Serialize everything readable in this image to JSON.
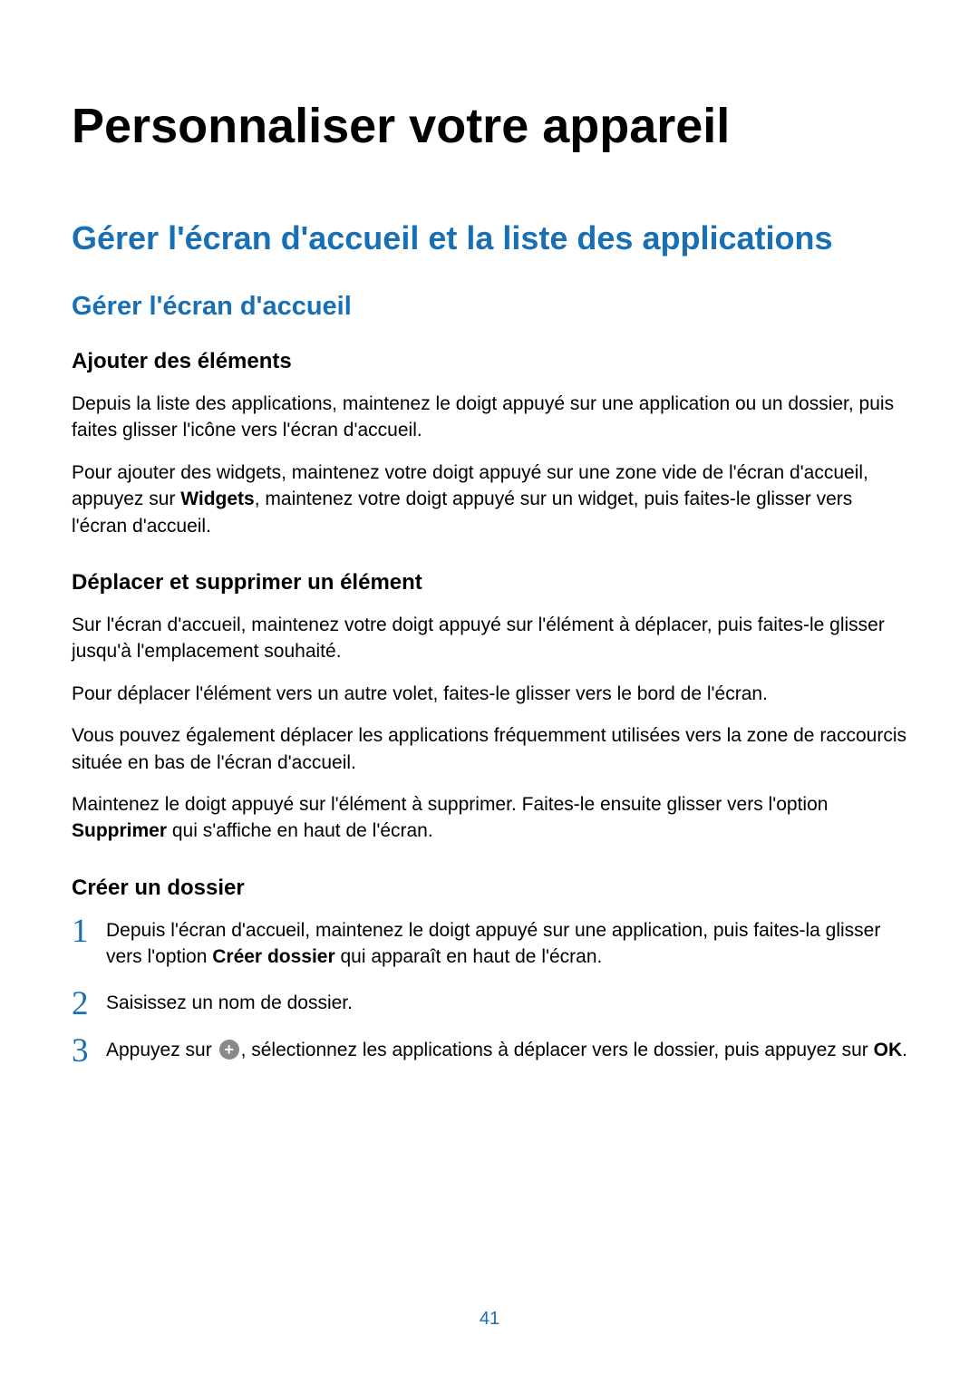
{
  "chapter_title": "Personnaliser votre appareil",
  "section_title": "Gérer l'écran d'accueil et la liste des applications",
  "subsection_title": "Gérer l'écran d'accueil",
  "topics": {
    "ajouter": {
      "title": "Ajouter des éléments",
      "p1": "Depuis la liste des applications, maintenez le doigt appuyé sur une application ou un dossier, puis faites glisser l'icône vers l'écran d'accueil.",
      "p2_pre": "Pour ajouter des widgets, maintenez votre doigt appuyé sur une zone vide de l'écran d'accueil, appuyez sur ",
      "p2_bold": "Widgets",
      "p2_post": ", maintenez votre doigt appuyé sur un widget, puis faites-le glisser vers l'écran d'accueil."
    },
    "deplacer": {
      "title": "Déplacer et supprimer un élément",
      "p1": "Sur l'écran d'accueil, maintenez votre doigt appuyé sur l'élément à déplacer, puis faites-le glisser jusqu'à l'emplacement souhaité.",
      "p2": "Pour déplacer l'élément vers un autre volet, faites-le glisser vers le bord de l'écran.",
      "p3": "Vous pouvez également déplacer les applications fréquemment utilisées vers la zone de raccourcis située en bas de l'écran d'accueil.",
      "p4_pre": "Maintenez le doigt appuyé sur l'élément à supprimer. Faites-le ensuite glisser vers l'option ",
      "p4_bold": "Supprimer",
      "p4_post": " qui s'affiche en haut de l'écran."
    },
    "creer": {
      "title": "Créer un dossier",
      "steps": {
        "s1_num": "1",
        "s1_pre": "Depuis l'écran d'accueil, maintenez le doigt appuyé sur une application, puis faites-la glisser vers l'option ",
        "s1_bold": "Créer dossier",
        "s1_post": " qui apparaît en haut de l'écran.",
        "s2_num": "2",
        "s2_text": "Saisissez un nom de dossier.",
        "s3_num": "3",
        "s3_pre": "Appuyez sur ",
        "s3_mid": ", sélectionnez les applications à déplacer vers le dossier, puis appuyez sur ",
        "s3_bold": "OK",
        "s3_post": "."
      }
    }
  },
  "page_number": "41"
}
